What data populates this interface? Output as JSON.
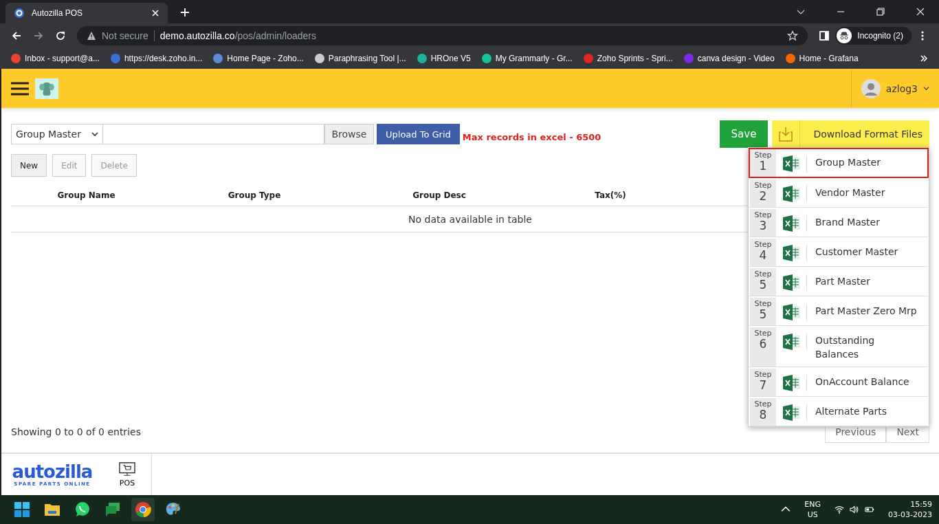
{
  "browser": {
    "tab_title": "Autozilla POS",
    "security": "Not secure",
    "url_host": "demo.autozilla.co",
    "url_path": "/pos/admin/loaders",
    "profile": "Incognito (2)",
    "bookmarks": [
      "Inbox - support@a...",
      "https://desk.zoho.in...",
      "Home Page - Zoho...",
      "Paraphrasing Tool |...",
      "HROne V5",
      "My Grammarly - Gr...",
      "Zoho Sprints - Spri...",
      "canva design - Video",
      "Home - Grafana"
    ]
  },
  "header": {
    "user": "azlog3"
  },
  "upload": {
    "master_select": "Group Master",
    "browse": "Browse",
    "upload_button": "Upload To Grid",
    "note": "Max records in excel - 6500"
  },
  "actions": [
    {
      "label": "New",
      "disabled": false
    },
    {
      "label": "Edit",
      "disabled": true
    },
    {
      "label": "Delete",
      "disabled": true
    }
  ],
  "save": "Save",
  "download": "Download Format Files",
  "table": {
    "columns": [
      "Group Name",
      "Group Type",
      "Group Desc",
      "Tax(%)"
    ],
    "empty": "No data available in table"
  },
  "info": "Showing 0 to 0 of 0 entries",
  "pager": [
    "Previous",
    "Next"
  ],
  "menu": [
    {
      "step_label": "Step",
      "step": "1",
      "label": "Group Master",
      "selected": true
    },
    {
      "step_label": "Step",
      "step": "2",
      "label": "Vendor Master",
      "selected": false
    },
    {
      "step_label": "Step",
      "step": "3",
      "label": "Brand Master",
      "selected": false
    },
    {
      "step_label": "Step",
      "step": "4",
      "label": "Customer Master",
      "selected": false
    },
    {
      "step_label": "Step",
      "step": "5",
      "label": "Part Master",
      "selected": false
    },
    {
      "step_label": "Step",
      "step": "5",
      "label": "Part Master Zero Mrp",
      "selected": false
    },
    {
      "step_label": "Step",
      "step": "6",
      "label": "Outstanding Balances",
      "selected": false
    },
    {
      "step_label": "Step",
      "step": "7",
      "label": "OnAccount Balance",
      "selected": false
    },
    {
      "step_label": "Step",
      "step": "8",
      "label": "Alternate Parts",
      "selected": false
    }
  ],
  "footer": {
    "logo": "autozilla",
    "tagline": "SPARE PARTS ONLINE",
    "nav": "POS"
  },
  "taskbar": {
    "lang": "ENG",
    "region": "US",
    "time": "15:59",
    "date": "03-03-2023"
  }
}
